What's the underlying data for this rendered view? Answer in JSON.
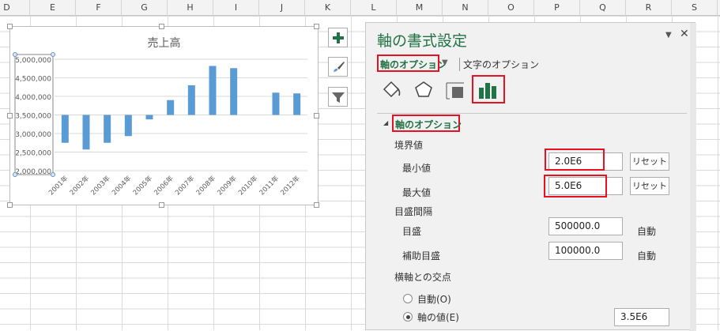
{
  "columns": [
    "D",
    "E",
    "F",
    "G",
    "H",
    "I",
    "J",
    "K",
    "L",
    "M",
    "N",
    "O",
    "P",
    "Q",
    "R",
    "S"
  ],
  "chart_data": {
    "type": "bar",
    "title": "売上高",
    "categories": [
      "2001年",
      "2002年",
      "2003年",
      "2004年",
      "2005年",
      "2006年",
      "2007年",
      "2008年",
      "2009年",
      "2010年",
      "2011年",
      "2012年"
    ],
    "values": [
      2750000,
      2570000,
      2750000,
      2930000,
      3380000,
      3900000,
      4300000,
      4820000,
      4760000,
      null,
      4100000,
      4080000
    ],
    "ylim": [
      2000000,
      5000000
    ],
    "yticks": [
      "5,000,000",
      "4,500,000",
      "4,000,000",
      "3,500,000",
      "3,000,000",
      "2,500,000",
      "2,000,000"
    ],
    "ytick_values": [
      5000000,
      4500000,
      4000000,
      3500000,
      3000000,
      2500000,
      2000000
    ],
    "axis_cross": 3500000,
    "bar_color": "#5b9bd5",
    "grid": true
  },
  "chart_buttons": {
    "add": "chart-elements",
    "style": "chart-styles",
    "filter": "chart-filters"
  },
  "panel": {
    "title": "軸の書式設定",
    "tab_axis": "軸のオプション",
    "tab_text": "文字のオプション",
    "section": "軸の書式設定",
    "section_label": "軸のオプション",
    "bounds_label": "境界値",
    "min_label": "最小値",
    "min_value": "2.0E6",
    "max_label": "最大値",
    "max_value": "5.0E6",
    "reset": "リセット",
    "units_label": "目盛間隔",
    "major_label": "目盛",
    "major_value": "500000.0",
    "minor_label": "補助目盛",
    "minor_value": "100000.0",
    "auto": "自動",
    "cross_label": "横軸との交点",
    "cross_auto": "自動(O)",
    "cross_value_label": "軸の値(E)",
    "cross_value": "3.5E6",
    "accent": "#217346"
  }
}
